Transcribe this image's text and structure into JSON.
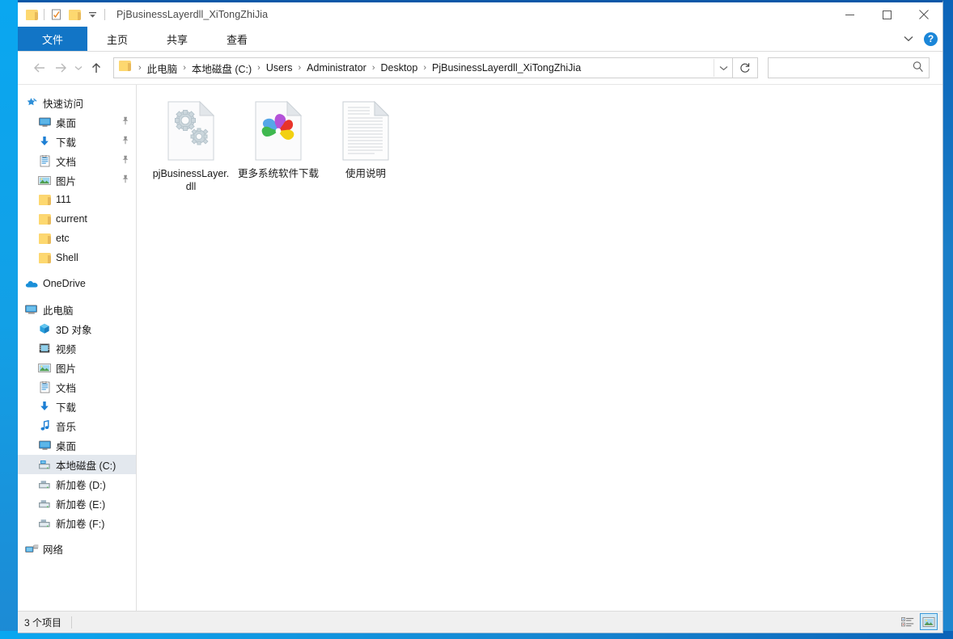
{
  "window": {
    "title": "PjBusinessLayerdll_XiTongZhiJia",
    "controls": {
      "minimize": "minimize-button",
      "maximize": "maximize-button",
      "close": "close-button"
    },
    "quick_access": [
      {
        "name": "folder-icon",
        "label": ""
      },
      {
        "name": "properties-icon",
        "label": ""
      },
      {
        "name": "new-folder-icon",
        "label": ""
      },
      {
        "name": "customize-qat-dropdown",
        "label": ""
      }
    ]
  },
  "ribbon": {
    "tabs": [
      {
        "id": "file",
        "label": "文件"
      },
      {
        "id": "home",
        "label": "主页"
      },
      {
        "id": "share",
        "label": "共享"
      },
      {
        "id": "view",
        "label": "查看"
      }
    ],
    "expand_label": "",
    "help_label": "?"
  },
  "nav": {
    "back_tooltip": "后退",
    "forward_tooltip": "前进",
    "recent_tooltip": "最近浏览的位置",
    "up_tooltip": "上移到",
    "breadcrumbs": [
      "此电脑",
      "本地磁盘 (C:)",
      "Users",
      "Administrator",
      "Desktop",
      "PjBusinessLayerdll_XiTongZhiJia"
    ],
    "separator": "›",
    "refresh_label": "↻",
    "search": {
      "value": "",
      "placeholder": ""
    }
  },
  "sidebar": {
    "quick_access": {
      "label": "快速访问",
      "icon": "star-pin-icon",
      "items": [
        {
          "label": "桌面",
          "icon": "desktop-icon",
          "pinned": true
        },
        {
          "label": "下载",
          "icon": "download-icon",
          "pinned": true
        },
        {
          "label": "文档",
          "icon": "documents-icon",
          "pinned": true
        },
        {
          "label": "图片",
          "icon": "pictures-icon",
          "pinned": true
        },
        {
          "label": "111",
          "icon": "folder-icon",
          "pinned": false
        },
        {
          "label": "current",
          "icon": "folder-icon",
          "pinned": false
        },
        {
          "label": "etc",
          "icon": "folder-icon",
          "pinned": false
        },
        {
          "label": "Shell",
          "icon": "folder-icon",
          "pinned": false
        }
      ]
    },
    "onedrive": {
      "label": "OneDrive",
      "icon": "onedrive-cloud-icon"
    },
    "this_pc": {
      "label": "此电脑",
      "icon": "computer-icon",
      "items": [
        {
          "label": "3D 对象",
          "icon": "3d-objects-icon"
        },
        {
          "label": "视频",
          "icon": "videos-icon"
        },
        {
          "label": "图片",
          "icon": "pictures-icon"
        },
        {
          "label": "文档",
          "icon": "documents-icon"
        },
        {
          "label": "下载",
          "icon": "download-icon"
        },
        {
          "label": "音乐",
          "icon": "music-icon"
        },
        {
          "label": "桌面",
          "icon": "desktop-icon"
        },
        {
          "label": "本地磁盘 (C:)",
          "icon": "system-drive-icon",
          "selected": true
        },
        {
          "label": "新加卷 (D:)",
          "icon": "drive-icon"
        },
        {
          "label": "新加卷 (E:)",
          "icon": "drive-icon"
        },
        {
          "label": "新加卷 (F:)",
          "icon": "drive-icon"
        }
      ]
    },
    "network": {
      "label": "网络",
      "icon": "network-icon"
    }
  },
  "files": [
    {
      "name": "pjBusinessLayer.dll",
      "icon": "dll-gear-file-icon"
    },
    {
      "name": "更多系统软件下载",
      "icon": "browser-shortcut-icon"
    },
    {
      "name": "使用说明",
      "icon": "text-document-icon"
    }
  ],
  "status": {
    "item_count": "3 个项目",
    "views": [
      {
        "id": "details",
        "icon": "details-view-icon",
        "selected": false
      },
      {
        "id": "large-icons",
        "icon": "large-icons-view-icon",
        "selected": true
      }
    ]
  },
  "colors": {
    "accent": "#1275c6",
    "titlebar_border": "#0a58a8",
    "selection": "#e3e8ee",
    "desktop": "#12a0e6"
  }
}
